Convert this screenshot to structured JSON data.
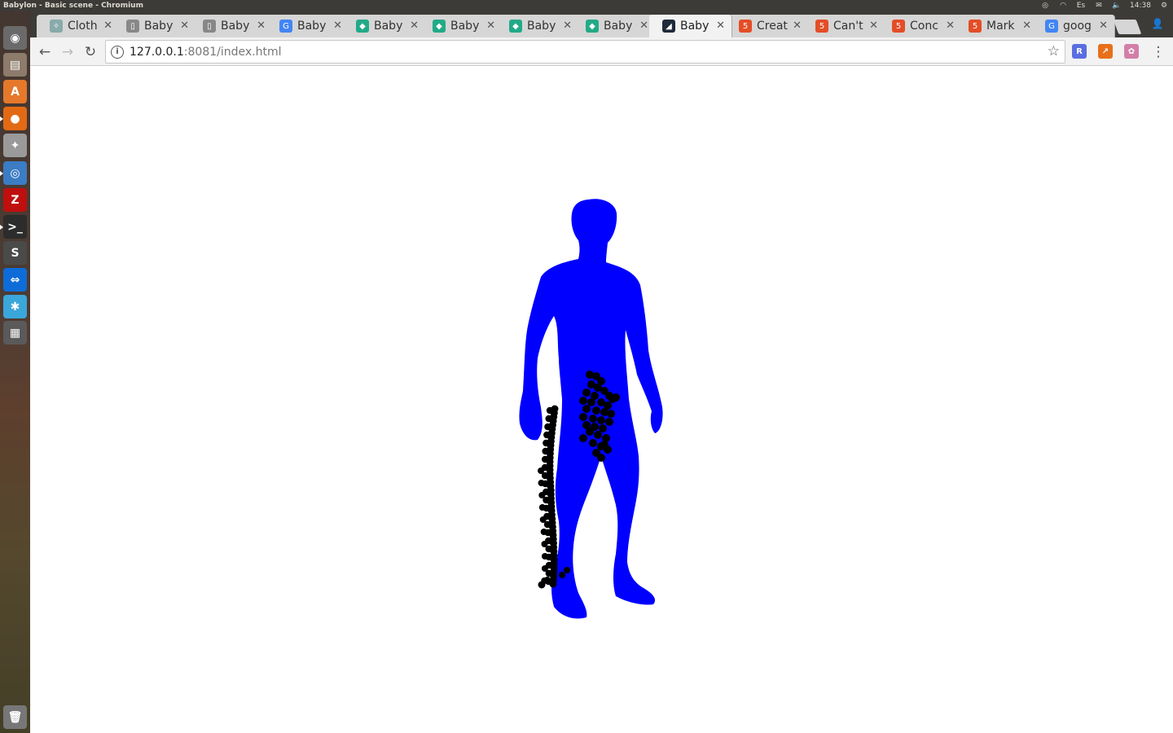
{
  "window": {
    "title": "Babylon - Basic scene - Chromium"
  },
  "system_tray": {
    "keyboard_layout": "Es",
    "clock": "14:38"
  },
  "launcher": {
    "items": [
      {
        "name": "dash-home",
        "icon": "ubuntu-logo-icon",
        "glyph": "◉",
        "color": "#6a6a6a"
      },
      {
        "name": "files",
        "icon": "file-cabinet-icon",
        "glyph": "▤",
        "color": "#8d7b6b"
      },
      {
        "name": "software-center",
        "icon": "software-center-icon",
        "glyph": "A",
        "color": "#e5782b"
      },
      {
        "name": "firefox",
        "icon": "firefox-icon",
        "glyph": "●",
        "color": "#e36a14"
      },
      {
        "name": "system-settings",
        "icon": "wrench-icon",
        "glyph": "✦",
        "color": "#9a9a9a"
      },
      {
        "name": "chromium",
        "icon": "chromium-icon",
        "glyph": "◎",
        "color": "#3b7cc4"
      },
      {
        "name": "filezilla",
        "icon": "filezilla-icon",
        "glyph": "Z",
        "color": "#bf0f0f"
      },
      {
        "name": "terminal",
        "icon": "terminal-icon",
        "glyph": ">_",
        "color": "#2c2c2c"
      },
      {
        "name": "sublime-text",
        "icon": "sublime-text-icon",
        "glyph": "S",
        "color": "#4a4a4a"
      },
      {
        "name": "teamviewer",
        "icon": "teamviewer-icon",
        "glyph": "⇔",
        "color": "#0e6cd8"
      },
      {
        "name": "app-blue",
        "icon": "sparkle-app-icon",
        "glyph": "✱",
        "color": "#3ba6d9"
      },
      {
        "name": "workspace-switcher",
        "icon": "workspace-switcher-icon",
        "glyph": "▦",
        "color": "#5a5a5a"
      }
    ],
    "trash": {
      "icon": "trash-icon",
      "glyph": "🗑"
    }
  },
  "tabs": [
    {
      "label": "Cloth",
      "favicon": "diagram-favicon-icon",
      "favicon_color": "#8aa",
      "favicon_glyph": "✧"
    },
    {
      "label": "Baby",
      "favicon": "document-favicon-icon",
      "favicon_color": "#888",
      "favicon_glyph": "▯"
    },
    {
      "label": "Baby",
      "favicon": "document-favicon-icon",
      "favicon_color": "#888",
      "favicon_glyph": "▯"
    },
    {
      "label": "Baby",
      "favicon": "google-favicon-icon",
      "favicon_color": "#4285f4",
      "favicon_glyph": "G"
    },
    {
      "label": "Baby",
      "favicon": "babylonjs-favicon-icon",
      "favicon_color": "#2a8",
      "favicon_glyph": "◆"
    },
    {
      "label": "Baby",
      "favicon": "babylonjs-favicon-icon",
      "favicon_color": "#2a8",
      "favicon_glyph": "◆"
    },
    {
      "label": "Baby",
      "favicon": "babylonjs-favicon-icon",
      "favicon_color": "#2a8",
      "favicon_glyph": "◆"
    },
    {
      "label": "Baby",
      "favicon": "babylonjs-favicon-icon",
      "favicon_color": "#2a8",
      "favicon_glyph": "◆"
    },
    {
      "label": "Baby",
      "favicon": "babylon-dark-favicon-icon",
      "favicon_color": "#1e2a3a",
      "favicon_glyph": "◢",
      "active": true
    },
    {
      "label": "Creat",
      "favicon": "html5-favicon-icon",
      "favicon_color": "#e44d26",
      "favicon_glyph": "5"
    },
    {
      "label": "Can't",
      "favicon": "html5-favicon-icon",
      "favicon_color": "#e44d26",
      "favicon_glyph": "5"
    },
    {
      "label": "Conc",
      "favicon": "html5-favicon-icon",
      "favicon_color": "#e44d26",
      "favicon_glyph": "5"
    },
    {
      "label": "Mark",
      "favicon": "html5-favicon-icon",
      "favicon_color": "#e44d26",
      "favicon_glyph": "5"
    },
    {
      "label": "goog",
      "favicon": "google-favicon-icon",
      "favicon_color": "#4285f4",
      "favicon_glyph": "G"
    }
  ],
  "toolbar": {
    "back_icon": "←",
    "forward_icon": "→",
    "reload_icon": "↻",
    "url_host": "127.0.0.1",
    "url_rest": ":8081/index.html",
    "bookmark_icon": "☆",
    "menu_icon": "⋮"
  },
  "extensions": [
    {
      "name": "extension-r",
      "icon": "shield-r-icon",
      "glyph": "R",
      "color": "#5b6ee1"
    },
    {
      "name": "extension-chart",
      "icon": "orange-chart-icon",
      "glyph": "↗",
      "color": "#e8701a"
    },
    {
      "name": "extension-flower",
      "icon": "flower-icon",
      "glyph": "✿",
      "color": "#d27fa8"
    }
  ],
  "scene": {
    "body_color": "#0000ff",
    "cloth_particle_color": "#000000",
    "background_color": "#ffffff"
  }
}
